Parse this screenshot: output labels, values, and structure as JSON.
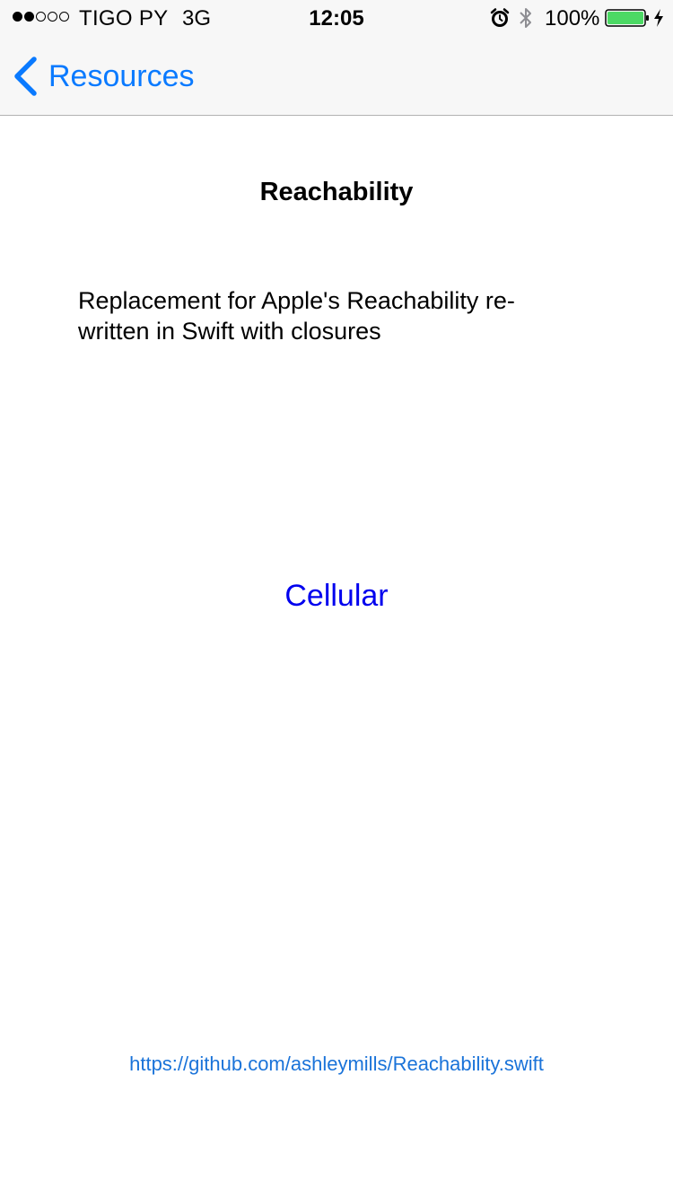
{
  "status_bar": {
    "signal_bars_filled": 2,
    "signal_bars_total": 5,
    "carrier": "TIGO PY",
    "network": "3G",
    "time": "12:05",
    "battery_percent": "100%",
    "battery_level": 1.0,
    "battery_color": "#4cd964",
    "icons": [
      "signal-dots-icon",
      "alarm-icon",
      "bluetooth-icon",
      "battery-icon",
      "charging-bolt-icon"
    ]
  },
  "nav": {
    "back_label": "Resources",
    "accent_color": "#0a7aff"
  },
  "main": {
    "title": "Reachability",
    "description_line_1": "Replacement for Apple's Reachability re-",
    "description_line_2": "written in Swift with closures",
    "status": "Cellular",
    "status_color": "#0000ee",
    "link": "https://github.com/ashleymills/Reachability.swift"
  }
}
